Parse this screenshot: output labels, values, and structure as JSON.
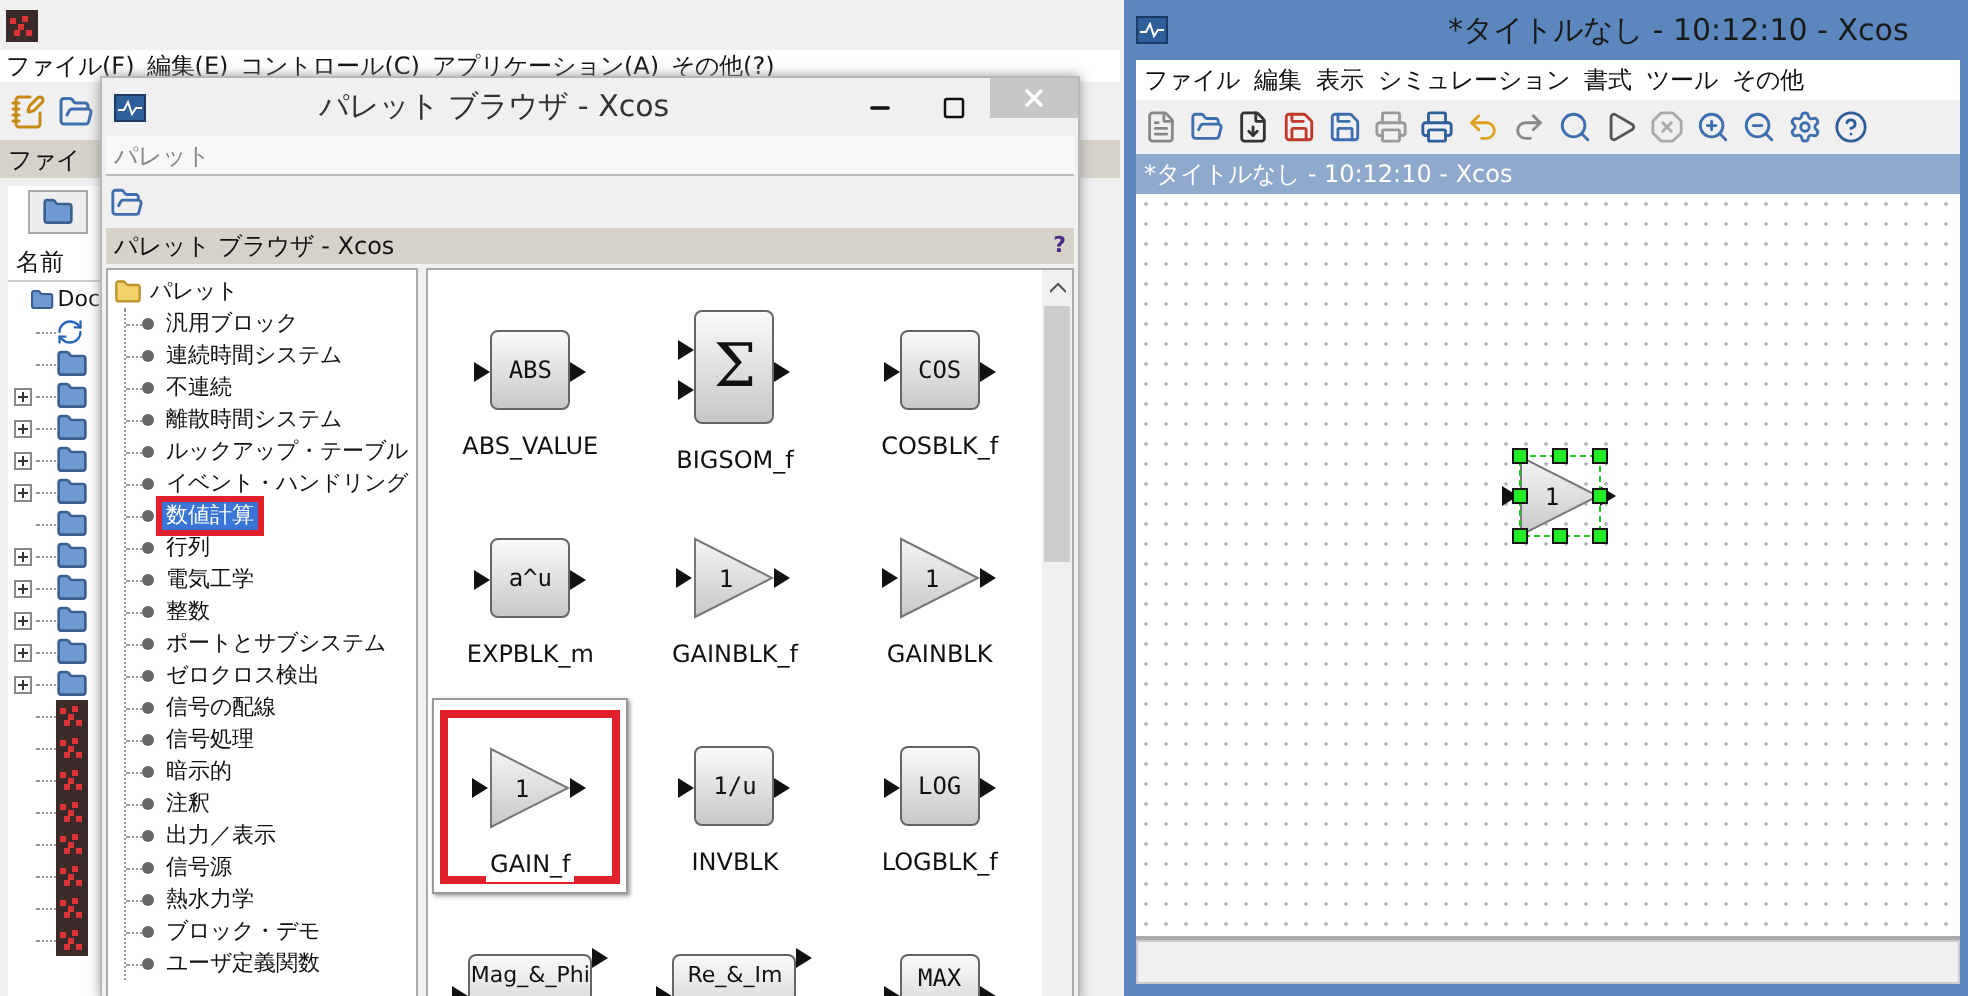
{
  "console_window": {
    "menu": [
      "ファイル(F)",
      "編集(E)",
      "コントロール(C)",
      "アプリケーション(A)",
      "その他(?)"
    ],
    "panel_title": "ファイ",
    "file_header": "名前",
    "file_tree": [
      {
        "kind": "folder",
        "label": "Doc",
        "expandable": false
      },
      {
        "kind": "link",
        "expandable": false
      },
      {
        "kind": "folder",
        "expandable": false
      },
      {
        "kind": "folder",
        "expandable": true
      },
      {
        "kind": "folder",
        "expandable": true
      },
      {
        "kind": "folder",
        "expandable": true
      },
      {
        "kind": "folder",
        "expandable": true
      },
      {
        "kind": "folder",
        "expandable": false
      },
      {
        "kind": "folder",
        "expandable": true
      },
      {
        "kind": "folder",
        "expandable": true
      },
      {
        "kind": "folder",
        "expandable": true
      },
      {
        "kind": "folder",
        "expandable": true
      },
      {
        "kind": "folder",
        "expandable": true
      },
      {
        "kind": "file",
        "expandable": false
      },
      {
        "kind": "file",
        "expandable": false
      },
      {
        "kind": "file",
        "expandable": false
      },
      {
        "kind": "file",
        "expandable": false
      },
      {
        "kind": "file",
        "expandable": false
      },
      {
        "kind": "file",
        "expandable": false
      },
      {
        "kind": "file",
        "expandable": false
      },
      {
        "kind": "file",
        "expandable": false
      }
    ]
  },
  "palette_window": {
    "title": "パレット ブラウザ - Xcos",
    "address": "パレット",
    "panel_title": "パレット ブラウザ - Xcos",
    "help": "?",
    "tree": {
      "label": "パレット",
      "children": [
        {
          "label": "汎用ブロック",
          "selected": false,
          "annotated": false
        },
        {
          "label": "連続時間システム",
          "selected": false,
          "annotated": false
        },
        {
          "label": "不連続",
          "selected": false,
          "annotated": false
        },
        {
          "label": "離散時間システム",
          "selected": false,
          "annotated": false
        },
        {
          "label": "ルックアップ・テーブル",
          "selected": false,
          "annotated": false
        },
        {
          "label": "イベント・ハンドリング",
          "selected": false,
          "annotated": false
        },
        {
          "label": "数値計算",
          "selected": true,
          "annotated": true
        },
        {
          "label": "行列",
          "selected": false,
          "annotated": false
        },
        {
          "label": "電気工学",
          "selected": false,
          "annotated": false
        },
        {
          "label": "整数",
          "selected": false,
          "annotated": false
        },
        {
          "label": "ポートとサブシステム",
          "selected": false,
          "annotated": false
        },
        {
          "label": "ゼロクロス検出",
          "selected": false,
          "annotated": false
        },
        {
          "label": "信号の配線",
          "selected": false,
          "annotated": false
        },
        {
          "label": "信号処理",
          "selected": false,
          "annotated": false
        },
        {
          "label": "暗示的",
          "selected": false,
          "annotated": false
        },
        {
          "label": "注釈",
          "selected": false,
          "annotated": false
        },
        {
          "label": "出力／表示",
          "selected": false,
          "annotated": false
        },
        {
          "label": "信号源",
          "selected": false,
          "annotated": false
        },
        {
          "label": "熱水力学",
          "selected": false,
          "annotated": false
        },
        {
          "label": "ブロック・デモ",
          "selected": false,
          "annotated": false
        },
        {
          "label": "ユーザ定義関数",
          "selected": false,
          "annotated": false
        }
      ]
    },
    "blocks": [
      {
        "kind": "box",
        "symbol": "ABS",
        "name": "ABS_VALUE",
        "selected": false,
        "annotated": false
      },
      {
        "kind": "sum",
        "symbol": "Σ",
        "name": "BIGSOM_f",
        "selected": false,
        "annotated": false
      },
      {
        "kind": "box",
        "symbol": "COS",
        "name": "COSBLK_f",
        "selected": false,
        "annotated": false
      },
      {
        "kind": "box",
        "symbol": "a^u",
        "name": "EXPBLK_m",
        "selected": false,
        "annotated": false
      },
      {
        "kind": "gain",
        "symbol": "1",
        "name": "GAINBLK_f",
        "selected": false,
        "annotated": false
      },
      {
        "kind": "gain",
        "symbol": "1",
        "name": "GAINBLK",
        "selected": false,
        "annotated": false
      },
      {
        "kind": "gain",
        "symbol": "1",
        "name": "GAIN_f",
        "selected": true,
        "annotated": true
      },
      {
        "kind": "box",
        "symbol": "1/u",
        "name": "INVBLK",
        "selected": false,
        "annotated": false
      },
      {
        "kind": "box",
        "symbol": "LOG",
        "name": "LOGBLK_f",
        "selected": false,
        "annotated": false
      },
      {
        "kind": "wide",
        "symbol": "Mag_&_Phi",
        "selected": false,
        "annotated": false
      },
      {
        "kind": "wide",
        "symbol": "Re_&_Im",
        "selected": false,
        "annotated": false
      },
      {
        "kind": "box",
        "symbol": "MAX",
        "selected": false,
        "annotated": false
      }
    ]
  },
  "xcos_window": {
    "title": "*タイトルなし - 10:12:10 - Xcos",
    "menu": [
      "ファイル",
      "編集",
      "表示",
      "シミュレーション",
      "書式",
      "ツール",
      "その他"
    ],
    "tab": "*タイトルなし - 10:12:10 - Xcos",
    "canvas_block": {
      "kind": "gain",
      "symbol": "1",
      "selected": true
    }
  }
}
